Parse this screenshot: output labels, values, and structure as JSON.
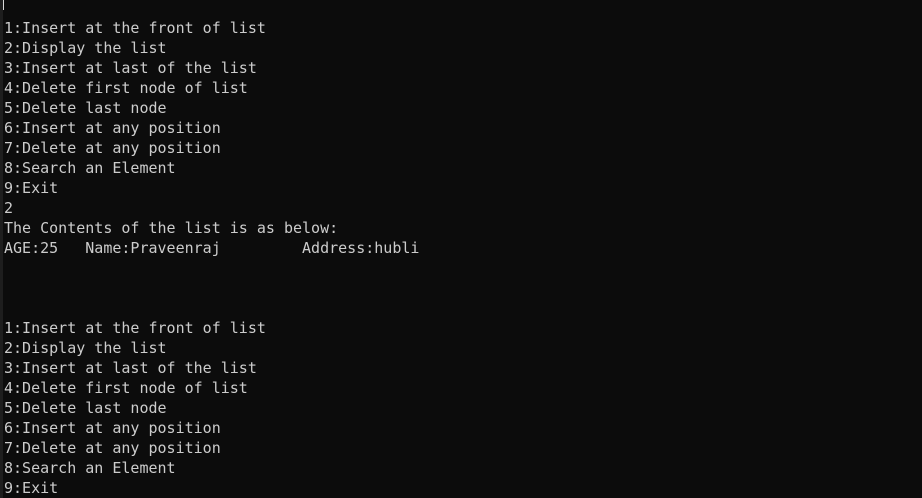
{
  "console": {
    "lines": [
      "1:Insert at the front of list",
      "2:Display the list",
      "3:Insert at last of the list",
      "4:Delete first node of list",
      "5:Delete last node",
      "6:Insert at any position",
      "7:Delete at any position",
      "8:Search an Element",
      "9:Exit",
      "2",
      "The Contents of the list is as below:",
      "AGE:25   Name:Praveenraj         Address:hubli",
      "",
      "",
      "",
      "1:Insert at the front of list",
      "2:Display the list",
      "3:Insert at last of the list",
      "4:Delete first node of list",
      "5:Delete last node",
      "6:Insert at any position",
      "7:Delete at any position",
      "8:Search an Element",
      "9:Exit"
    ]
  }
}
